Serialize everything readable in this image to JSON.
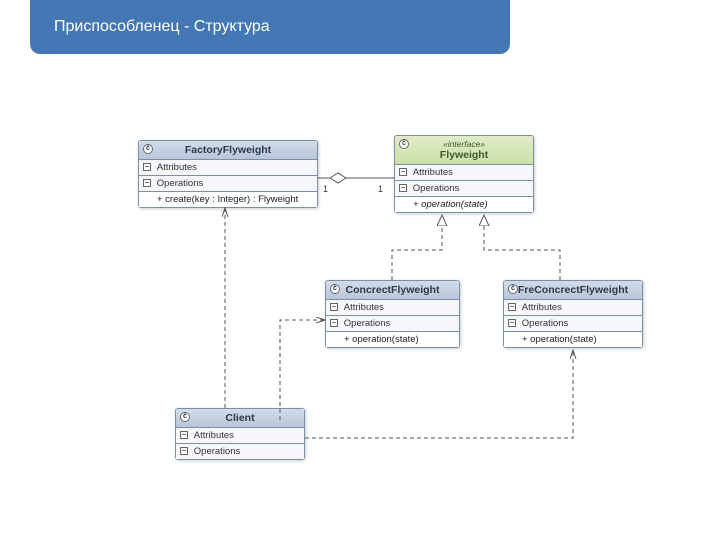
{
  "header": {
    "title": "Приспособленец - Структура"
  },
  "classes": {
    "factory": {
      "name": "FactoryFlyweight",
      "attr_label": "Attributes",
      "ops_label": "Operations",
      "op1": "+ create(key : Integer) : Flyweight"
    },
    "flyweight": {
      "stereo": "«interface»",
      "name": "Flyweight",
      "attr_label": "Attributes",
      "ops_label": "Operations",
      "op1": "+ operation(state)"
    },
    "concrete": {
      "name": "ConcrectFlyweight",
      "attr_label": "Attributes",
      "ops_label": "Operations",
      "op1": "+ operation(state)"
    },
    "free": {
      "name": "FreConcrectFlyweight",
      "attr_label": "Attributes",
      "ops_label": "Operations",
      "op1": "+ operation(state)"
    },
    "client": {
      "name": "Client",
      "attr_label": "Attributes",
      "ops_label": "Operations"
    }
  },
  "multiplicities": {
    "factory_side": "1",
    "flyweight_side": "1"
  },
  "toggle": {
    "minus": "−"
  }
}
